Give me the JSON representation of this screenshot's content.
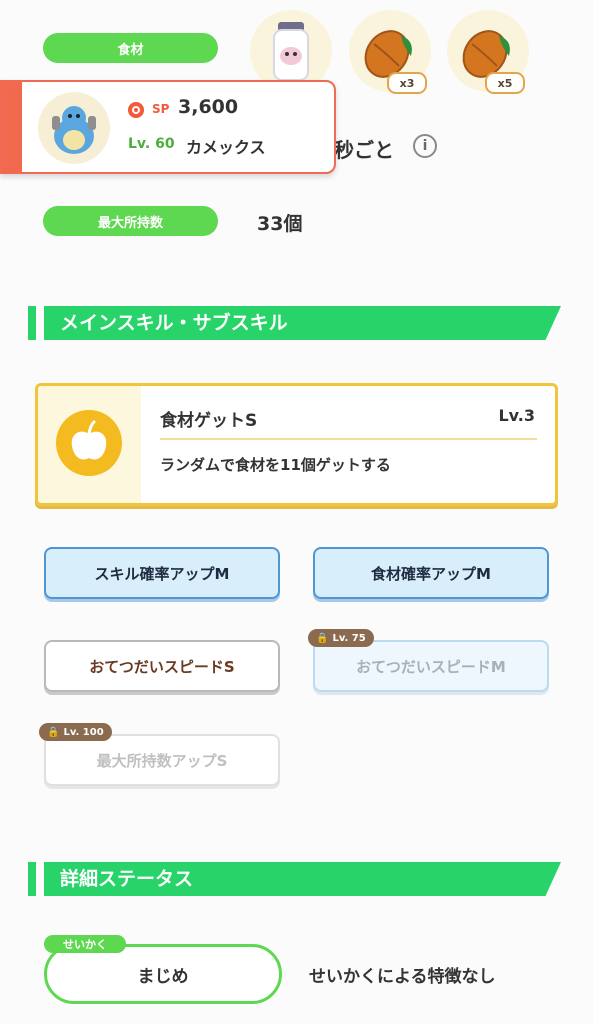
{
  "ingredients": {
    "label": "食材",
    "items": [
      {
        "icon": "moomoo-milk-icon",
        "qty": ""
      },
      {
        "icon": "cacao-icon",
        "qty": "x3"
      },
      {
        "icon": "cacao-icon",
        "qty": "x5"
      }
    ]
  },
  "pokemon_card": {
    "sp_label": "SP",
    "sp_value": "3,600",
    "level": "Lv. 60",
    "name": "カメックス"
  },
  "help_interval": {
    "suffix": "秒ごと",
    "info_icon": "info-icon"
  },
  "max_carry": {
    "label": "最大所持数",
    "value": "33個"
  },
  "skills_section": {
    "title": "メインスキル・サブスキル"
  },
  "main_skill": {
    "name": "食材ゲットS",
    "level": "Lv.3",
    "description": "ランダムで食材を11個ゲットする",
    "icon": "apple-icon"
  },
  "sub_skills": [
    {
      "label": "スキル確率アップM",
      "lock": ""
    },
    {
      "label": "食材確率アップM",
      "lock": ""
    },
    {
      "label": "おてつだいスピードS",
      "lock": ""
    },
    {
      "label": "おてつだいスピードM",
      "lock": "Lv. 75"
    },
    {
      "label": "最大所持数アップS",
      "lock": "Lv. 100"
    }
  ],
  "status_section": {
    "title": "詳細ステータス"
  },
  "nature": {
    "tag": "せいかく",
    "value": "まじめ",
    "effect": "せいかくによる特徴なし"
  },
  "colors": {
    "green": "#28d46a",
    "pill_green": "#5fd851",
    "gold": "#f1c232",
    "blue": "#4f97d4"
  }
}
